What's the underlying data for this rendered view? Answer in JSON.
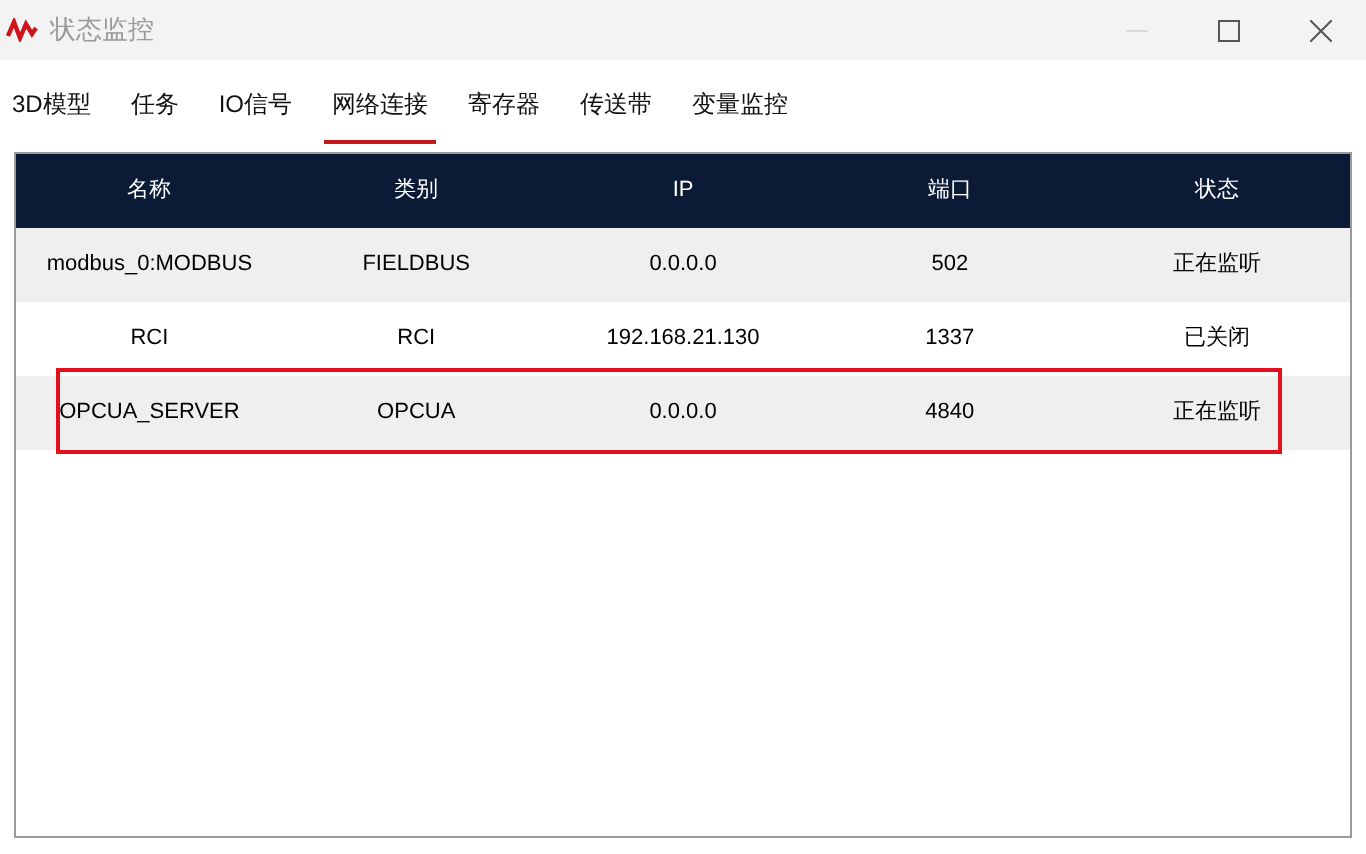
{
  "window": {
    "title": "状态监控"
  },
  "tabs": [
    {
      "label": "3D模型",
      "selected": false
    },
    {
      "label": "任务",
      "selected": false
    },
    {
      "label": "IO信号",
      "selected": false
    },
    {
      "label": "网络连接",
      "selected": true
    },
    {
      "label": "寄存器",
      "selected": false
    },
    {
      "label": "传送带",
      "selected": false
    },
    {
      "label": "变量监控",
      "selected": false
    }
  ],
  "table": {
    "columns": [
      "名称",
      "类别",
      "IP",
      "端口",
      "状态"
    ],
    "rows": [
      {
        "cells": [
          "modbus_0:MODBUS",
          "FIELDBUS",
          "0.0.0.0",
          "502",
          "正在监听"
        ],
        "highlighted": false
      },
      {
        "cells": [
          "RCI",
          "RCI",
          "192.168.21.130",
          "1337",
          "已关闭"
        ],
        "highlighted": false
      },
      {
        "cells": [
          "OPCUA_SERVER",
          "OPCUA",
          "0.0.0.0",
          "4840",
          "正在监听"
        ],
        "highlighted": true
      }
    ]
  }
}
